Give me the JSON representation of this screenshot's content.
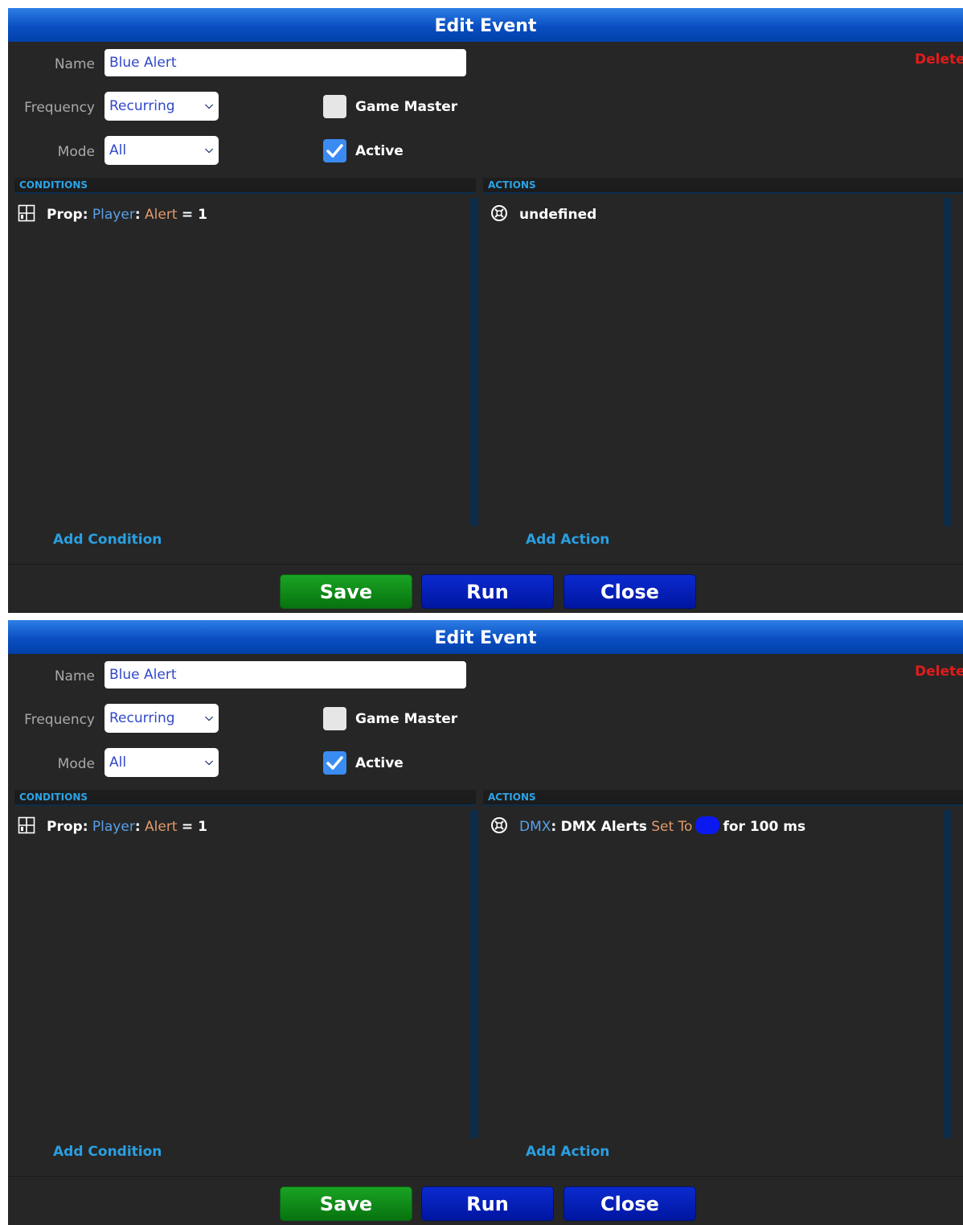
{
  "dialogs": [
    {
      "title": "Edit Event",
      "name_label": "Name",
      "name_value": "Blue Alert",
      "delete_label": "Delete",
      "frequency_label": "Frequency",
      "frequency_value": "Recurring",
      "mode_label": "Mode",
      "mode_value": "All",
      "game_master_label": "Game Master",
      "game_master_checked": false,
      "active_label": "Active",
      "active_checked": true,
      "conditions_header": "CONDITIONS",
      "actions_header": "ACTIONS",
      "condition": {
        "icon": "prop-grid-icon",
        "prefix": "Prop:",
        "target": "Player",
        "sep": ":",
        "prop": "Alert",
        "expr": "= 1"
      },
      "action": {
        "icon": "dmx-icon",
        "text": "undefined"
      },
      "add_condition": "Add Condition",
      "add_action": "Add Action",
      "save_label": "Save",
      "run_label": "Run",
      "close_label": "Close"
    },
    {
      "title": "Edit Event",
      "name_label": "Name",
      "name_value": "Blue Alert",
      "delete_label": "Delete",
      "frequency_label": "Frequency",
      "frequency_value": "Recurring",
      "mode_label": "Mode",
      "mode_value": "All",
      "game_master_label": "Game Master",
      "game_master_checked": false,
      "active_label": "Active",
      "active_checked": true,
      "conditions_header": "CONDITIONS",
      "actions_header": "ACTIONS",
      "condition": {
        "icon": "prop-grid-icon",
        "prefix": "Prop:",
        "target": "Player",
        "sep": ":",
        "prop": "Alert",
        "expr": "= 1"
      },
      "action": {
        "icon": "dmx-icon",
        "type": "DMX",
        "sep": ":",
        "device": "DMX Alerts",
        "verb": "Set To",
        "color": "#0b19f0",
        "duration": "for 100 ms"
      },
      "add_condition": "Add Condition",
      "add_action": "Add Action",
      "save_label": "Save",
      "run_label": "Run",
      "close_label": "Close"
    }
  ]
}
